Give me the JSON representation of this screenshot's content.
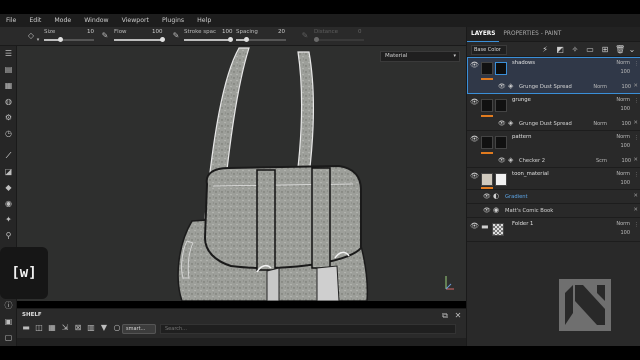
{
  "menu": [
    "File",
    "Edit",
    "Mode",
    "Window",
    "Viewport",
    "Plugins",
    "Help"
  ],
  "toolbar": {
    "size_label": "Size",
    "size_value": "10",
    "flow_label": "Flow",
    "flow_value": "100",
    "stroke_label": "Stroke spac",
    "stroke_value": "100",
    "spacing_label": "Spacing",
    "spacing_value": "20",
    "distance_label": "Distance",
    "distance_value": "0"
  },
  "viewport": {
    "mode": "Material"
  },
  "watermark": "[w]",
  "shelf": {
    "title": "SHELF",
    "tag": "smart...",
    "search_placeholder": "Search..."
  },
  "panel": {
    "tabs": [
      "LAYERS",
      "PROPERTIES - PAINT"
    ],
    "blend_mode": "Base Color",
    "layers": [
      {
        "name": "shadows",
        "blend": "Norm",
        "opacity": "100",
        "thumb": "black",
        "sub": {
          "name": "Grunge Dust Spread",
          "blend": "Norm",
          "opacity": "100"
        }
      },
      {
        "name": "grunge",
        "blend": "Norm",
        "opacity": "100",
        "thumb": "black",
        "sub": {
          "name": "Grunge Dust Spread",
          "blend": "Norm",
          "opacity": "100"
        }
      },
      {
        "name": "pattern",
        "blend": "Norm",
        "opacity": "100",
        "thumb": "black",
        "sub": {
          "name": "Checker 2",
          "blend": "Scrn",
          "opacity": "100"
        }
      },
      {
        "name": "toon_material",
        "blend": "Norm",
        "opacity": "100",
        "thumb": "white"
      }
    ],
    "effects": [
      {
        "name": "Gradient",
        "highlight": true
      },
      {
        "name": "Matt's Comic Book",
        "highlight": false
      }
    ],
    "folder": {
      "name": "Folder 1",
      "blend": "Norm",
      "opacity": "100"
    }
  }
}
